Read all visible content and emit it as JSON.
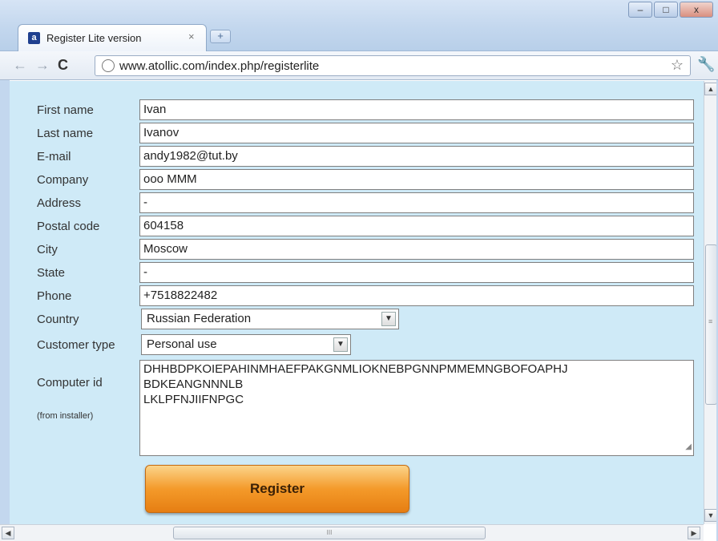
{
  "browser": {
    "tab_title": "Register Lite version",
    "tab_close": "×",
    "new_tab": "+",
    "favicon_letter": "a",
    "window_buttons": {
      "minimize": "–",
      "maximize": "□",
      "close": "x"
    },
    "nav": {
      "back": "←",
      "forward": "→",
      "reload": "C"
    },
    "url": "www.atollic.com/index.php/registerlite",
    "bookmark_star": "☆",
    "wrench": "🔧"
  },
  "form": {
    "fields": [
      {
        "label": "First name",
        "value": "Ivan"
      },
      {
        "label": "Last name",
        "value": "Ivanov"
      },
      {
        "label": "E-mail",
        "value": "andy1982@tut.by"
      },
      {
        "label": "Company",
        "value": "ooo MMM"
      },
      {
        "label": "Address",
        "value": "-"
      },
      {
        "label": "Postal code",
        "value": "604158"
      },
      {
        "label": "City",
        "value": "Moscow"
      },
      {
        "label": "State",
        "value": "-"
      },
      {
        "label": "Phone",
        "value": "+7518822482"
      }
    ],
    "country": {
      "label": "Country",
      "selected": "Russian Federation"
    },
    "customer_type": {
      "label": "Customer type",
      "selected": "Personal use"
    },
    "computer_id": {
      "label": "Computer id",
      "sub_label": "(from installer)",
      "lines": [
        "DHHBDPKOIEPAHINMHAEFPAKGNMLIOKNEBPGNNPMMEMNGBOFOAPHJ",
        "BDKEANGNNNLB",
        "LKLPFNJIIFNPGC"
      ]
    },
    "register_label": "Register"
  },
  "scrollbars": {
    "up": "▲",
    "down": "▼",
    "left": "◀",
    "right": "▶",
    "grip": "III",
    "vgrip": "≡"
  }
}
